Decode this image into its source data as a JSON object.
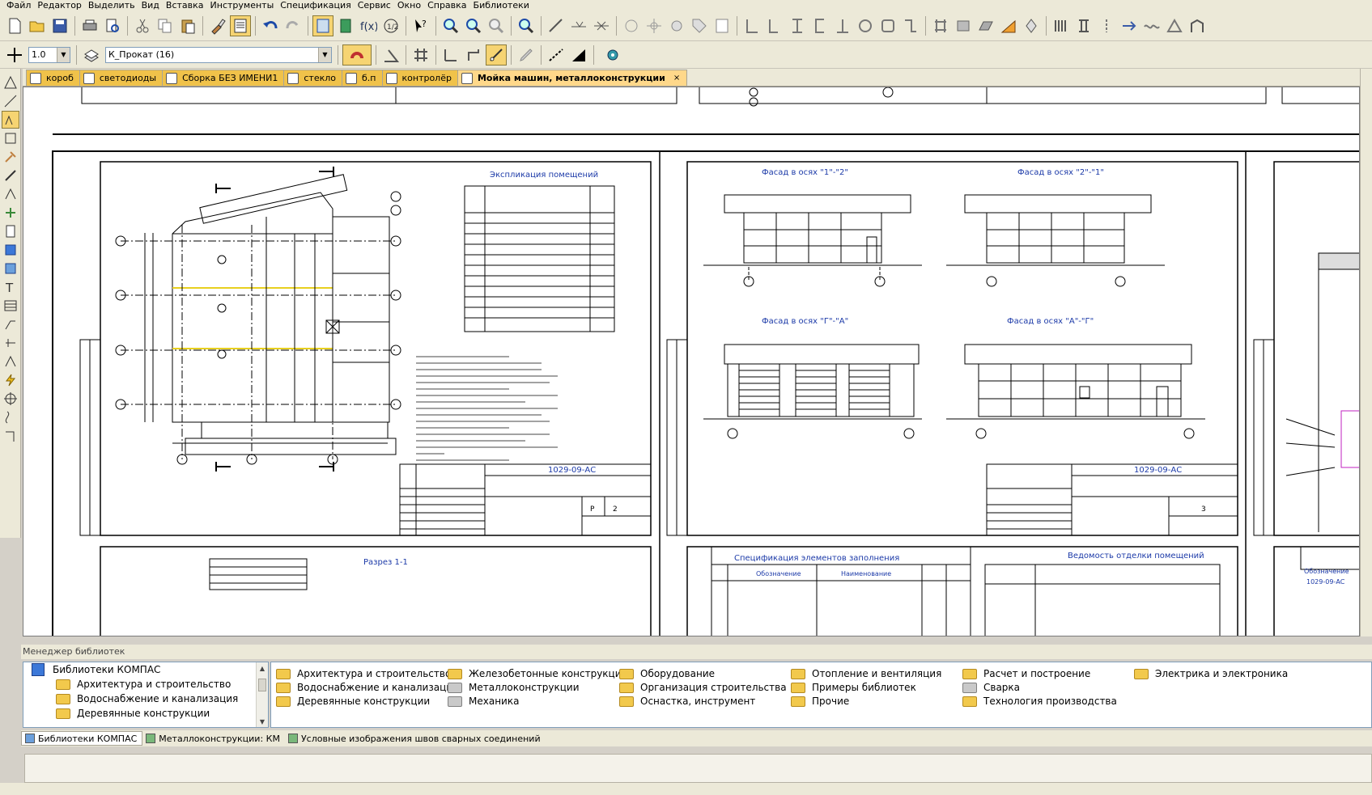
{
  "menu": [
    "Файл",
    "Редактор",
    "Выделить",
    "Вид",
    "Вставка",
    "Инструменты",
    "Спецификация",
    "Сервис",
    "Окно",
    "Справка",
    "Библиотеки"
  ],
  "toolbar2": {
    "scale_value": "1.0",
    "layer_style": "К_Прокат (16)"
  },
  "tabs": [
    {
      "label": "короб",
      "active": false
    },
    {
      "label": "светодиоды",
      "active": false
    },
    {
      "label": "Сборка БЕЗ ИМЕНИ1",
      "active": false
    },
    {
      "label": "стекло",
      "active": false
    },
    {
      "label": "б.п",
      "active": false
    },
    {
      "label": "контролёр",
      "active": false
    },
    {
      "label": "Мойка машин, металлоконструкции",
      "active": true,
      "close": "×"
    }
  ],
  "drawing": {
    "sheet1_title": "Экспликация помещений",
    "sheet1_code": "1029-09-АС",
    "sheet2_code": "1029-09-АС",
    "facade1": "Фасад в осях \"1\"-\"2\"",
    "facade2": "Фасад в осях \"2\"-\"1\"",
    "facade3": "Фасад в осях \"Г\"-\"А\"",
    "facade4": "Фасад в осях \"А\"-\"Г\"",
    "spec_title": "Спецификация элементов заполнения",
    "finish_title": "Ведомость отделки помещений",
    "section_title": "Разрез 1-1",
    "spec_col1": "Обозначение",
    "spec_col2": "Наименование",
    "right_label": "Обозначение",
    "right_code": "1029-09-АС",
    "sheet_p": "Р",
    "sheet_num1": "2",
    "sheet_num2": "3"
  },
  "library": {
    "header": "Менеджер библиотек",
    "tree_root": "Библиотеки КОМПАС",
    "tree_items": [
      "Архитектура и строительство",
      "Водоснабжение и канализация",
      "Деревянные конструкции"
    ],
    "grid": [
      {
        "label": "Архитектура и строительство",
        "gray": false
      },
      {
        "label": "Водоснабжение и канализация",
        "gray": false
      },
      {
        "label": "Деревянные конструкции",
        "gray": false
      },
      {
        "label": "Железобетонные конструкции",
        "gray": false
      },
      {
        "label": "Металлоконструкции",
        "gray": true
      },
      {
        "label": "Механика",
        "gray": true
      },
      {
        "label": "Оборудование",
        "gray": false
      },
      {
        "label": "Организация строительства",
        "gray": false
      },
      {
        "label": "Оснастка, инструмент",
        "gray": false
      },
      {
        "label": "Отопление и вентиляция",
        "gray": false
      },
      {
        "label": "Примеры библиотек",
        "gray": false
      },
      {
        "label": "Прочие",
        "gray": false
      },
      {
        "label": "Расчет и построение",
        "gray": false
      },
      {
        "label": "Сварка",
        "gray": true
      },
      {
        "label": "Технология производства",
        "gray": false
      },
      {
        "label": "Электрика и электроника",
        "gray": false
      }
    ],
    "bottom_tabs": [
      "Библиотеки КОМПАС",
      "Металлоконструкции: КМ",
      "Условные изображения швов сварных соединений"
    ]
  }
}
